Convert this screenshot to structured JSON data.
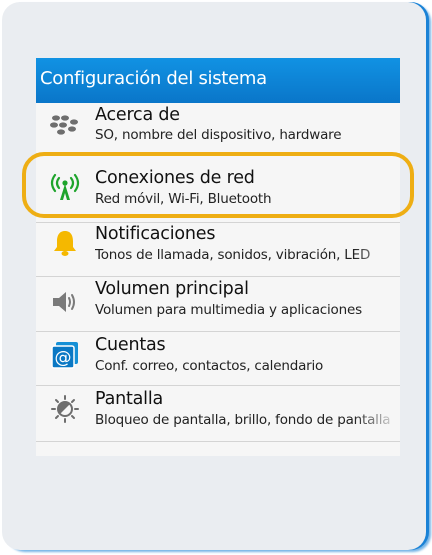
{
  "window": {
    "title": "Configuración del sistema"
  },
  "settings": {
    "items": [
      {
        "label": "Acerca de",
        "sublabel": "SO, nombre del dispositivo, hardware",
        "icon": "blackberry-logo-icon"
      },
      {
        "label": "Conexiones de red",
        "sublabel": "Red móvil, Wi-Fi, Bluetooth",
        "icon": "antenna-signal-icon",
        "highlighted": true
      },
      {
        "label": "Notificaciones",
        "sublabel": "Tonos de llamada, sonidos, vibración, LED",
        "icon": "bell-icon"
      },
      {
        "label": "Volumen principal",
        "sublabel": "Volumen para multimedia y aplicaciones",
        "icon": "speaker-icon"
      },
      {
        "label": "Cuentas",
        "sublabel": "Conf. correo, contactos, calendario",
        "icon": "at-sign-icon"
      },
      {
        "label": "Pantalla",
        "sublabel": "Bloqueo de pantalla, brillo, fondo de pantalla",
        "icon": "brightness-icon"
      }
    ]
  },
  "colors": {
    "accent": "#0a84d6",
    "highlight": "#eeae14",
    "bell": "#f5b800",
    "antenna": "#1ea42c"
  }
}
